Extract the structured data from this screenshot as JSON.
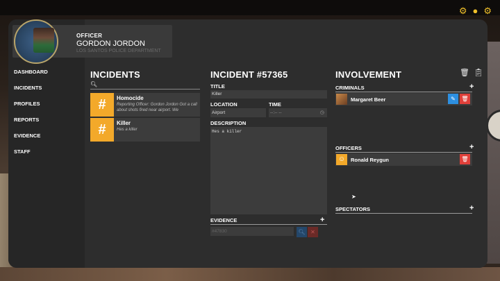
{
  "top_icons": [
    "gear-icon",
    "bell-icon",
    "settings-icon"
  ],
  "officer": {
    "rank": "OFFICER",
    "name": "GORDON JORDON",
    "subtitle": "LOS SANTOS POLICE DEPARTMENT"
  },
  "nav": [
    "DASHBOARD",
    "INCIDENTS",
    "PROFILES",
    "REPORTS",
    "EVIDENCE",
    "STAFF"
  ],
  "incidents": {
    "title": "INCIDENTS",
    "search_placeholder": "",
    "items": [
      {
        "title": "Homocide",
        "desc": "Reporting Officer: Gordon Jordon Got a call about shots fired near airport. We",
        "icon": "#"
      },
      {
        "title": "Killer",
        "desc": "Hes a killer",
        "icon": "#"
      }
    ]
  },
  "incident": {
    "title": "INCIDENT #57365",
    "title_label": "TITLE",
    "title_value": "Killer",
    "location_label": "LOCATION",
    "location_value": "Airport",
    "time_label": "TIME",
    "time_value": "--:-- --",
    "description_label": "DESCRIPTION",
    "description_value": "Hes a killer",
    "evidence_label": "EVIDENCE",
    "evidence_placeholder": "#47830"
  },
  "involvement": {
    "title": "INVOLVEMENT",
    "criminals_label": "CRIMINALS",
    "criminals": [
      {
        "name": "Margaret Beer"
      }
    ],
    "officers_label": "OFFICERS",
    "officers": [
      {
        "name": "Ronald Reygun"
      }
    ],
    "spectators_label": "SPECTATORS"
  },
  "colors": {
    "accent_orange": "#f3a92a",
    "edit_blue": "#2d8fe0",
    "delete_red": "#e0403a",
    "panel_bg": "#2b2b2b"
  }
}
